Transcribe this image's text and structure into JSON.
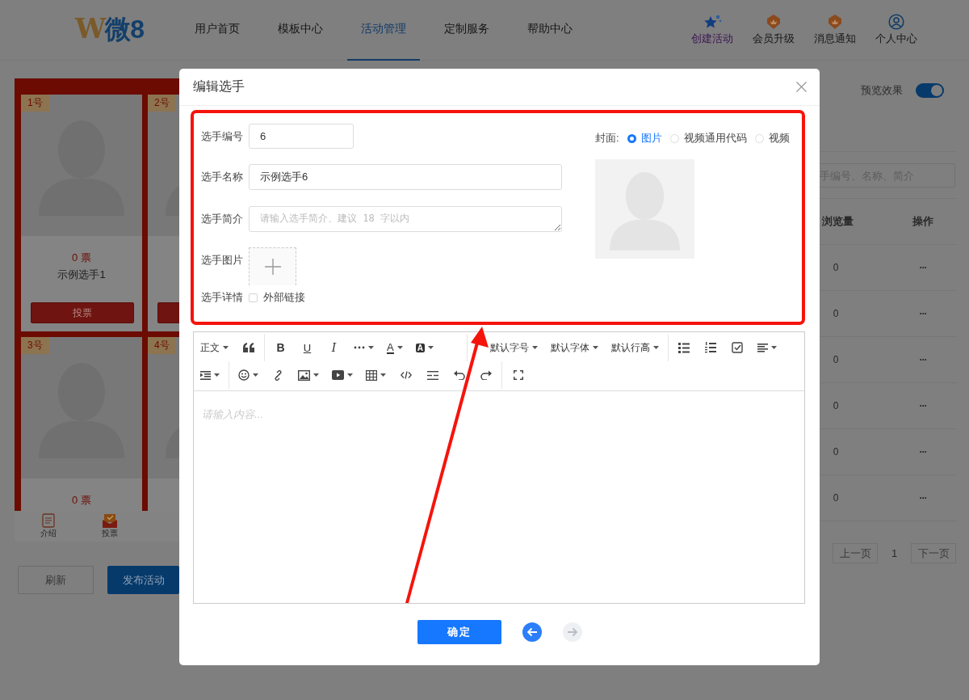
{
  "header": {
    "logo_mark": "W",
    "logo_text": "微8",
    "nav": [
      {
        "label": "用户首页",
        "selected": false
      },
      {
        "label": "模板中心",
        "selected": false
      },
      {
        "label": "活动管理",
        "selected": true
      },
      {
        "label": "定制服务",
        "selected": false
      },
      {
        "label": "帮助中心",
        "selected": false
      }
    ],
    "actions": [
      {
        "label": "创建活动",
        "kind": "create"
      },
      {
        "label": "会员升级",
        "kind": "upgrade"
      },
      {
        "label": "消息通知",
        "kind": "notice"
      },
      {
        "label": "个人中心",
        "kind": "profile"
      }
    ]
  },
  "preview": {
    "cards": [
      {
        "badge": "1号",
        "votes": "0 票",
        "name": "示例选手1",
        "has_button": true,
        "button_label": "投票"
      },
      {
        "badge": "2号",
        "has_button": true
      },
      {
        "badge": "3号",
        "votes": "0 票",
        "has_button": false
      },
      {
        "badge": "4号",
        "has_button": false
      }
    ],
    "bottom_nav": [
      {
        "label": "介绍",
        "kind": "intro"
      },
      {
        "label": "投票",
        "kind": "vote"
      }
    ]
  },
  "page_buttons": [
    {
      "label": "刷新",
      "kind": "plain"
    },
    {
      "label": "发布活动",
      "kind": "primary"
    }
  ],
  "preview_toggle": {
    "label": "预览效果",
    "on": true
  },
  "search": {
    "placeholder": "手编号、名称、简介"
  },
  "table": {
    "columns": [
      "浏览量",
      "操作"
    ],
    "rows": [
      {
        "views": "0",
        "action": "···"
      },
      {
        "views": "0",
        "action": "···"
      },
      {
        "views": "0",
        "action": "···"
      },
      {
        "views": "0",
        "action": "···"
      },
      {
        "views": "0",
        "action": "···"
      },
      {
        "views": "0",
        "action": "···"
      }
    ]
  },
  "pagination": {
    "prev": "上一页",
    "page": "1",
    "next": "下一页"
  },
  "dialog": {
    "title": "编辑选手",
    "number": {
      "label": "选手编号",
      "value": "6"
    },
    "name": {
      "label": "选手名称",
      "value": "示例选手6"
    },
    "intro": {
      "label": "选手简介",
      "placeholder": "请输入选手简介、建议 18 字以内"
    },
    "image": {
      "label": "选手图片"
    },
    "details": {
      "label": "选手详情",
      "checkbox": "外部链接",
      "checked": false
    },
    "cover": {
      "label": "封面:",
      "options": [
        {
          "label": "图片",
          "selected": true
        },
        {
          "label": "视频通用代码",
          "selected": false
        },
        {
          "label": "视频",
          "selected": false
        }
      ]
    },
    "editor": {
      "texts": [
        "正文",
        "B",
        "U",
        "I",
        "A",
        "A",
        "默认字号",
        "默认字体",
        "默认行高"
      ],
      "placeholder": "请输入内容..."
    },
    "confirm": "确定",
    "prev": {
      "disabled": false
    },
    "next": {
      "disabled": true
    }
  }
}
